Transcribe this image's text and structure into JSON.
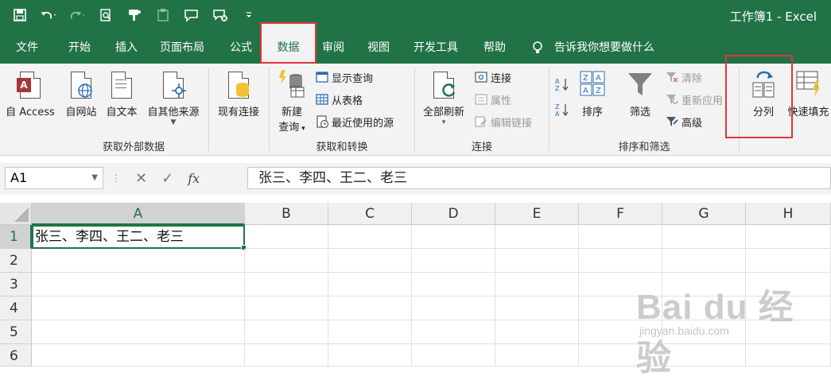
{
  "window": {
    "title": "工作簿1 - Excel"
  },
  "qat": {
    "icons": [
      "save-icon",
      "undo-icon",
      "redo-icon",
      "print-preview-icon",
      "format-painter-icon",
      "paste-icon",
      "comment-icon",
      "clear-comment-icon",
      "customize-qat-icon"
    ]
  },
  "tabs": {
    "items": [
      "文件",
      "开始",
      "插入",
      "页面布局",
      "公式",
      "数据",
      "审阅",
      "视图",
      "开发工具",
      "帮助"
    ],
    "active": "数据",
    "tell_me": "告诉我你想要做什么"
  },
  "ribbon": {
    "get_external": {
      "label": "获取外部数据",
      "buttons": [
        "自 Access",
        "自网站",
        "自文本",
        "自其他来源",
        "现有连接"
      ]
    },
    "get_transform": {
      "label": "获取和转换",
      "new_query_line1": "新建",
      "new_query_line2": "查询",
      "show_queries": "显示查询",
      "from_table": "从表格",
      "recent_sources": "最近使用的源"
    },
    "connections": {
      "label": "连接",
      "refresh_all": "全部刷新",
      "connections": "连接",
      "properties": "属性",
      "edit_links": "编辑链接"
    },
    "sort_filter": {
      "label": "排序和筛选",
      "sort": "排序",
      "filter": "筛选",
      "clear": "清除",
      "reapply": "重新应用",
      "advanced": "高级"
    },
    "data_tools": {
      "text_to_columns": "分列",
      "flash_fill": "快速填充"
    }
  },
  "formula_bar": {
    "name_box": "A1",
    "fx": "fx",
    "content": "张三、李四、王二、老三"
  },
  "grid": {
    "columns": [
      "A",
      "B",
      "C",
      "D",
      "E",
      "F",
      "G",
      "H"
    ],
    "rows": [
      "1",
      "2",
      "3",
      "4",
      "5",
      "6"
    ],
    "a1": "张三、李四、王二、老三"
  },
  "watermark": {
    "main": "Bai du 经验",
    "sub": "jingyan.baidu.com"
  },
  "accent": "#217346",
  "highlight": "#e0353a"
}
